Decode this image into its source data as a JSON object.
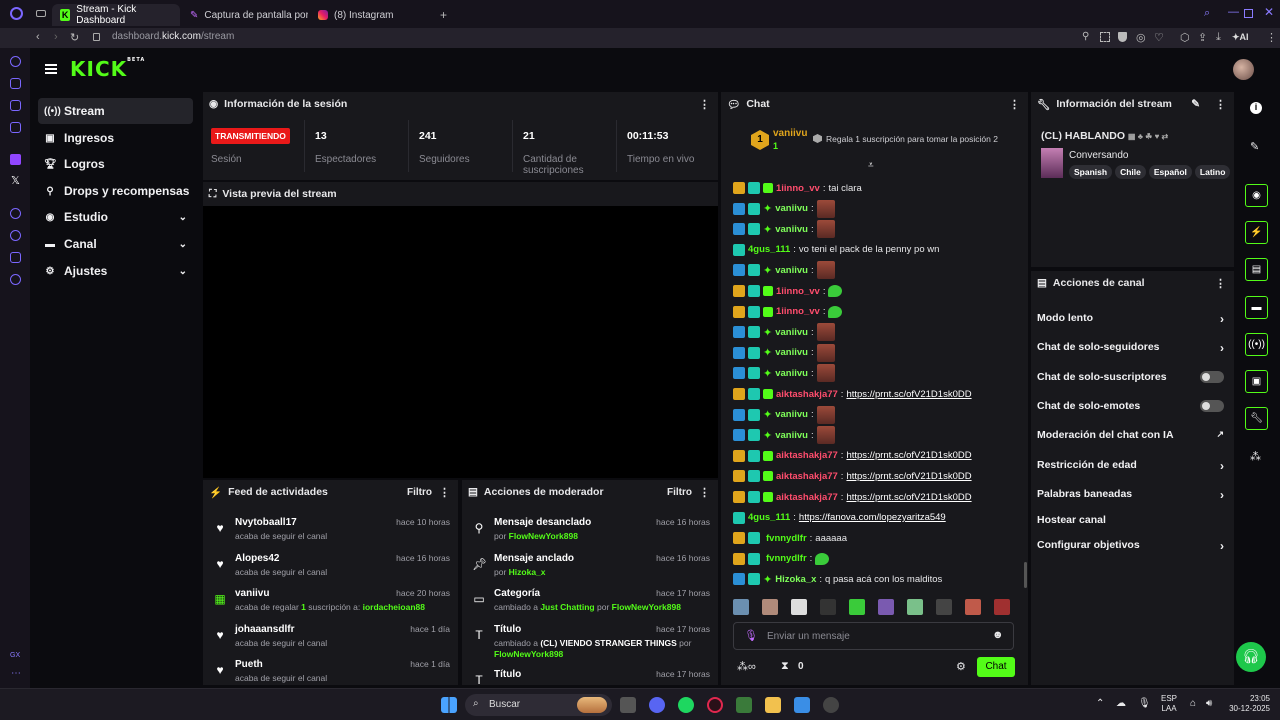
{
  "browser": {
    "tabs": [
      {
        "label": "Stream - Kick Dashboard"
      },
      {
        "label": "Captura de pantalla por Le"
      },
      {
        "label": "(8) Instagram"
      }
    ],
    "url_prefix": "dashboard.",
    "url_domain": "kick.com",
    "url_path": "/stream",
    "ai_label": "AI"
  },
  "sidebar": {
    "items": [
      {
        "label": "Stream"
      },
      {
        "label": "Ingresos"
      },
      {
        "label": "Logros"
      },
      {
        "label": "Drops y recompensas"
      },
      {
        "label": "Estudio"
      },
      {
        "label": "Canal"
      },
      {
        "label": "Ajustes"
      }
    ]
  },
  "logo": {
    "text": "KICK",
    "badge": "BETA"
  },
  "session": {
    "title": "Información de la sesión",
    "live_badge": "TRANSMITIENDO",
    "live_label": "Sesión",
    "stats": [
      {
        "value": "13",
        "label": "Espectadores"
      },
      {
        "value": "241",
        "label": "Seguidores"
      },
      {
        "value": "21",
        "label": "Cantidad de suscripciones"
      },
      {
        "value": "00:11:53",
        "label": "Tiempo en vivo"
      }
    ]
  },
  "preview": {
    "title": "Vista previa del stream"
  },
  "feed": {
    "title": "Feed de actividades",
    "filter": "Filtro",
    "items": [
      {
        "name": "Nvytobaall17",
        "time": "hace 10 horas",
        "sub": "acaba de seguir el canal"
      },
      {
        "name": "Alopes42",
        "time": "hace 16 horas",
        "sub": "acaba de seguir el canal"
      },
      {
        "name": "vaniivu",
        "time": "hace 20 horas",
        "sub_a": "acaba de regalar ",
        "sub_b": "1",
        "sub_c": " suscripción a: ",
        "sub_d": "iordacheioan88"
      },
      {
        "name": "johaaansdlfr",
        "time": "hace 1 día",
        "sub": "acaba de seguir el canal"
      },
      {
        "name": "Pueth",
        "time": "hace 1 día",
        "sub": "acaba de seguir el canal"
      }
    ]
  },
  "modactions": {
    "title": "Acciones de moderador",
    "filter": "Filtro",
    "items": [
      {
        "name": "Mensaje desanclado",
        "time": "hace 16 horas",
        "by": "por ",
        "who": "FlowNewYork898"
      },
      {
        "name": "Mensaje anclado",
        "time": "hace 16 horas",
        "by": "por ",
        "who": "Hizoka_x"
      },
      {
        "name": "Categoría",
        "time": "hace 17 horas",
        "pre": "cambiado a ",
        "cat": "Just Chatting",
        "by": " por ",
        "who": "FlowNewYork898"
      },
      {
        "name": "Título",
        "time": "hace 17 horas",
        "pre": "cambiado a ",
        "cat": "(CL) VIENDO STRANGER THINGS",
        "by": " por ",
        "who": "FlowNewYork898"
      },
      {
        "name": "Título",
        "time": "hace 17 horas"
      }
    ]
  },
  "chat": {
    "title": "Chat",
    "top_gifter": {
      "name": "vaniivu",
      "count": "1",
      "promo": "Regala 1 suscripción para tomar la posición 2"
    },
    "messages": [
      {
        "user": "1iinno_vv",
        "color": "pink",
        "text": "tai clara"
      },
      {
        "user": "vaniivu",
        "color": "lime",
        "emote": true
      },
      {
        "user": "vaniivu",
        "color": "lime",
        "emote": true
      },
      {
        "user": "4gus_111",
        "color": "green",
        "text": "vo teni el pack de la penny po wn"
      },
      {
        "user": "vaniivu",
        "color": "lime",
        "emote": true
      },
      {
        "user": "1iinno_vv",
        "color": "pink",
        "gemote": true
      },
      {
        "user": "1iinno_vv",
        "color": "pink",
        "gemote": true
      },
      {
        "user": "vaniivu",
        "color": "lime",
        "emote": true
      },
      {
        "user": "vaniivu",
        "color": "lime",
        "emote": true
      },
      {
        "user": "vaniivu",
        "color": "lime",
        "emote": true
      },
      {
        "user": "aiktashakja77",
        "color": "pink",
        "link": "https://prnt.sc/ofV21D1sk0DD"
      },
      {
        "user": "vaniivu",
        "color": "lime",
        "emote": true
      },
      {
        "user": "vaniivu",
        "color": "lime",
        "emote": true
      },
      {
        "user": "aiktashakja77",
        "color": "pink",
        "link": "https://prnt.sc/ofV21D1sk0DD"
      },
      {
        "user": "aiktashakja77",
        "color": "pink",
        "link": "https://prnt.sc/ofV21D1sk0DD"
      },
      {
        "user": "aiktashakja77",
        "color": "pink",
        "link": "https://prnt.sc/ofV21D1sk0DD"
      },
      {
        "user": "4gus_111",
        "color": "green",
        "link": "https://fanova.com/lopezyaritza549"
      },
      {
        "user": "fvnnydlfr",
        "color": "green",
        "text": "aaaaaa"
      },
      {
        "user": "fvnnydlfr",
        "color": "green",
        "gemote": true
      },
      {
        "user": "Hizoka_x",
        "color": "lime",
        "text": "q pasa acá con los malditos"
      }
    ],
    "input_placeholder": "Enviar un mensaje",
    "count": "0",
    "send_label": "Chat"
  },
  "streaminfo": {
    "title": "Información del stream",
    "stream_title": "(CL) HABLANDO",
    "category": "Conversando",
    "tags": [
      "Spanish",
      "Chile",
      "Español",
      "Latino"
    ]
  },
  "channelactions": {
    "title": "Acciones de canal",
    "items": [
      {
        "label": "Modo lento",
        "kind": "chevron"
      },
      {
        "label": "Chat de solo-seguidores",
        "kind": "chevron"
      },
      {
        "label": "Chat de solo-suscriptores",
        "kind": "toggle"
      },
      {
        "label": "Chat de solo-emotes",
        "kind": "toggle"
      },
      {
        "label": "Moderación del chat con IA",
        "kind": "external"
      },
      {
        "label": "Restricción de edad",
        "kind": "chevron"
      },
      {
        "label": "Palabras baneadas",
        "kind": "chevron"
      },
      {
        "label": "Hostear canal",
        "kind": "none"
      },
      {
        "label": "Configurar objetivos",
        "kind": "chevron"
      }
    ]
  },
  "taskbar": {
    "search": "Buscar",
    "lang1": "ESP",
    "lang2": "LAA",
    "time": "23:05",
    "date": "30-12-2025"
  },
  "colors": {
    "accent": "#53fc18",
    "live": "#e91919",
    "panel": "#18181c",
    "bg": "#0b0b0f"
  }
}
